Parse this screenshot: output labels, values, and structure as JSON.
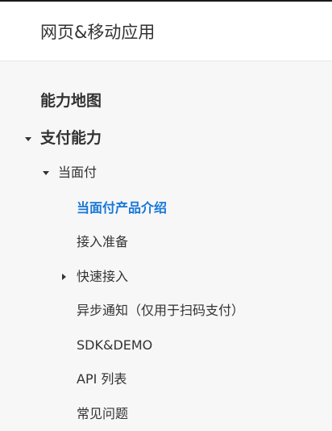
{
  "header": {
    "title": "网页&移动应用"
  },
  "nav": {
    "capability_map": "能力地图",
    "payment_capability": "支付能力",
    "face_to_face_pay": "当面付",
    "items": [
      "当面付产品介绍",
      "接入准备",
      "快速接入",
      "异步通知（仅用于扫码支付）",
      "SDK&DEMO",
      "API 列表",
      "常见问题"
    ],
    "active_item": "当面付产品介绍",
    "arrow_icons": {
      "payment_capability": "caret-down-icon",
      "face_to_face_pay": "caret-down-icon",
      "quick_access": "caret-right-icon"
    }
  },
  "colors": {
    "active": "#1677d9",
    "text": "#333333",
    "background": "#f7f7f7",
    "header_background": "#ffffff"
  }
}
